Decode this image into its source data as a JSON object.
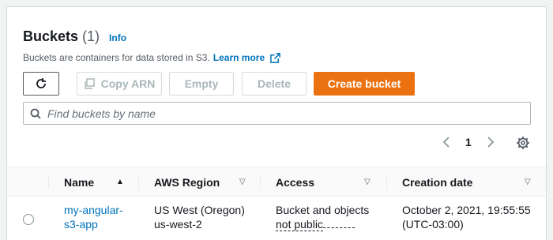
{
  "header": {
    "title": "Buckets",
    "count": "(1)",
    "info": "Info"
  },
  "description": {
    "text": "Buckets are containers for data stored in S3.",
    "learn_more": "Learn more"
  },
  "toolbar": {
    "copy_arn": "Copy ARN",
    "empty": "Empty",
    "delete": "Delete",
    "create": "Create bucket"
  },
  "search": {
    "placeholder": "Find buckets by name"
  },
  "pagination": {
    "page": "1"
  },
  "table": {
    "columns": [
      "Name",
      "AWS Region",
      "Access",
      "Creation date"
    ],
    "rows": [
      {
        "name_line1": "my-angular-",
        "name_line2": "s3-app",
        "region_line1": "US West (Oregon)",
        "region_line2": "us-west-2",
        "access_line1": "Bucket and objects",
        "access_line2": "not public",
        "date_line1": "October 2, 2021, 19:55:55",
        "date_line2": "(UTC-03:00)"
      }
    ]
  },
  "colors": {
    "primary": "#ec7211",
    "link": "#0073bb"
  },
  "icons": [
    "refresh-icon",
    "copy-icon",
    "external-link-icon",
    "search-icon",
    "chevron-left-icon",
    "chevron-right-icon",
    "gear-icon",
    "sort-ascending-icon",
    "sort-icon"
  ]
}
